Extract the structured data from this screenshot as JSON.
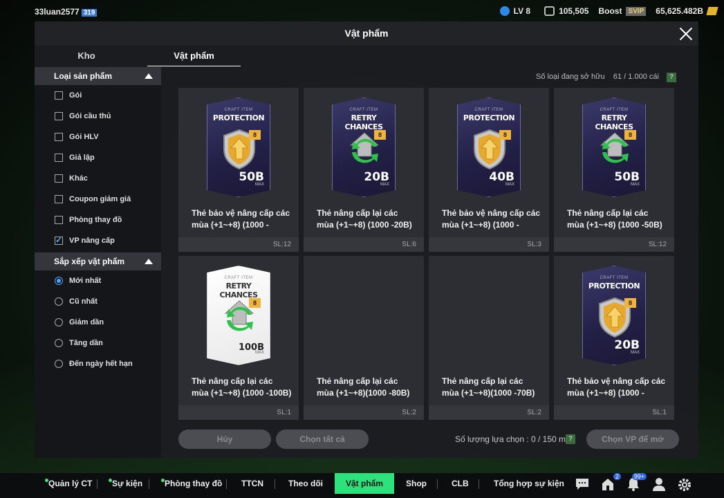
{
  "topbar": {
    "username": "33luan2577",
    "user_badge": "319",
    "level": "LV 8",
    "coins": "105,505",
    "boost": "Boost",
    "svip": "SVIP",
    "bp": "65,625.482B"
  },
  "panel": {
    "title": "Vật phẩm",
    "tabs": [
      "Kho",
      "Vật phẩm"
    ]
  },
  "sidebar": {
    "product_type_label": "Loại sản phẩm",
    "product_types": [
      {
        "label": "Gói",
        "checked": false
      },
      {
        "label": "Gói cầu thủ",
        "checked": false
      },
      {
        "label": "Gói HLV",
        "checked": false
      },
      {
        "label": "Giả lập",
        "checked": false
      },
      {
        "label": "Khác",
        "checked": false
      },
      {
        "label": "Coupon giảm giá",
        "checked": false
      },
      {
        "label": "Phòng thay đồ",
        "checked": false
      },
      {
        "label": "VP nâng cấp",
        "checked": true
      }
    ],
    "sort_label": "Sắp xếp vật phẩm",
    "sort_options": [
      {
        "label": "Mới nhất",
        "selected": true
      },
      {
        "label": "Cũ nhất",
        "selected": false
      },
      {
        "label": "Giảm dần",
        "selected": false
      },
      {
        "label": "Tăng dần",
        "selected": false
      },
      {
        "label": "Đến ngày hết hạn",
        "selected": false
      }
    ]
  },
  "owned": {
    "label": "Số loại đang sở hữu",
    "value": "61 / 1.000 cái",
    "help": "?"
  },
  "items": [
    {
      "craft": "CRAFT ITEM",
      "type": "PROTECTION",
      "level": "8",
      "value": "50B",
      "max": "MAX",
      "name": "Thẻ bảo vệ nâng cấp các mùa (+1~+8) (1000 -",
      "qty": "SL:12",
      "style": "dark",
      "visible": true
    },
    {
      "craft": "CRAFT ITEM",
      "type": "RETRY CHANCES",
      "level": "8",
      "value": "20B",
      "max": "MAX",
      "name": "Thẻ nâng cấp lại các mùa (+1~+8) (1000 -20B)",
      "qty": "SL:6",
      "style": "dark",
      "visible": true
    },
    {
      "craft": "CRAFT ITEM",
      "type": "PROTECTION",
      "level": "8",
      "value": "40B",
      "max": "MAX",
      "name": "Thẻ bảo vệ nâng cấp các mùa (+1~+8) (1000 -",
      "qty": "SL:3",
      "style": "dark",
      "visible": true
    },
    {
      "craft": "CRAFT ITEM",
      "type": "RETRY CHANCES",
      "level": "8",
      "value": "50B",
      "max": "MAX",
      "name": "Thẻ nâng cấp lại các mùa (+1~+8) (1000 -50B)",
      "qty": "SL:12",
      "style": "dark",
      "visible": true
    },
    {
      "craft": "CRAFT ITEM",
      "type": "RETRY CHANCES",
      "level": "8",
      "value": "100B",
      "max": "MAX",
      "name": "Thẻ nâng cấp lại các mùa (+1~+8) (1000 -100B)",
      "qty": "SL:1",
      "style": "white",
      "visible": true
    },
    {
      "craft": "",
      "type": "",
      "level": "",
      "value": "",
      "max": "",
      "name": "Thẻ nâng cấp lại các mùa (+1~+8)(1000 -80B)",
      "qty": "SL:2",
      "style": "none",
      "visible": false
    },
    {
      "craft": "",
      "type": "",
      "level": "",
      "value": "",
      "max": "",
      "name": "Thẻ nâng cấp lại các mùa (+1~+8)(1000 -70B)",
      "qty": "SL:2",
      "style": "none",
      "visible": false
    },
    {
      "craft": "CRAFT ITEM",
      "type": "PROTECTION",
      "level": "8",
      "value": "20B",
      "max": "MAX",
      "name": "Thẻ bảo vệ nâng cấp các mùa (+1~+8) (1000 -",
      "qty": "SL:1",
      "style": "dark",
      "visible": true
    }
  ],
  "actions": {
    "cancel": "Hủy",
    "select_all": "Chọn tất cả",
    "selection_count": "Số lượng lựa chọn : 0 / 150 món",
    "help": "?",
    "select_vp": "Chọn VP để mở"
  },
  "bottom_nav": {
    "items": [
      "Quản lý CT",
      "Sự kiện",
      "Phòng thay đồ",
      "TTCN",
      "Theo dõi",
      "Vật phẩm",
      "Shop",
      "CLB",
      "Tổng hợp sự kiện"
    ],
    "active": "Vật phẩm",
    "gift_badge": "2",
    "bell_badge": "99+"
  },
  "colors": {
    "accent_green": "#2ee27b",
    "check_blue": "#4ea6ff",
    "card_purple": "#221f45",
    "level_gold": "#f0b43c"
  }
}
